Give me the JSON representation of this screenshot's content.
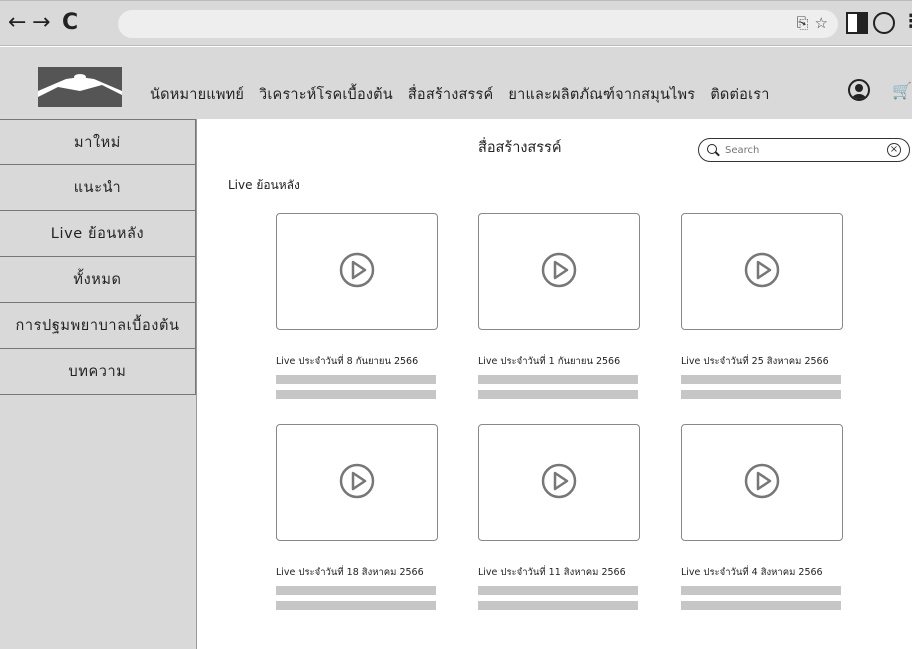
{
  "browser": {
    "back": "←",
    "forward": "→",
    "reload": "C",
    "share_icon": "⎘",
    "star_icon": "☆",
    "menu": "⋮"
  },
  "header": {
    "nav": [
      "นัดหมายแพทย์",
      "วิเคราะห์โรคเบื้องต้น",
      "สื่อสร้างสรรค์",
      "ยาและผลิตภัณฑ์จากสมุนไพร",
      "ติดต่อเรา"
    ],
    "cart_icon": "🛒"
  },
  "sidebar": {
    "items": [
      "มาใหม่",
      "แนะนำ",
      "Live ย้อนหลัง",
      "ทั้งหมด",
      "การปฐมพยาบาลเบื้องต้น",
      "บทความ"
    ]
  },
  "main": {
    "title": "สื่อสร้างสรรค์",
    "search_placeholder": "Search",
    "clear": "×",
    "section_label": "Live ย้อนหลัง",
    "videos": [
      "Live ประจำวันที่ 8 กันยายน 2566",
      "Live ประจำวันที่ 1 กันยายน 2566",
      "Live ประจำวันที่ 25 สิงหาคม 2566",
      "Live ประจำวันที่ 18 สิงหาคม 2566",
      "Live ประจำวันที่ 11 สิงหาคม 2566",
      "Live ประจำวันที่ 4 สิงหาคม 2566"
    ]
  }
}
